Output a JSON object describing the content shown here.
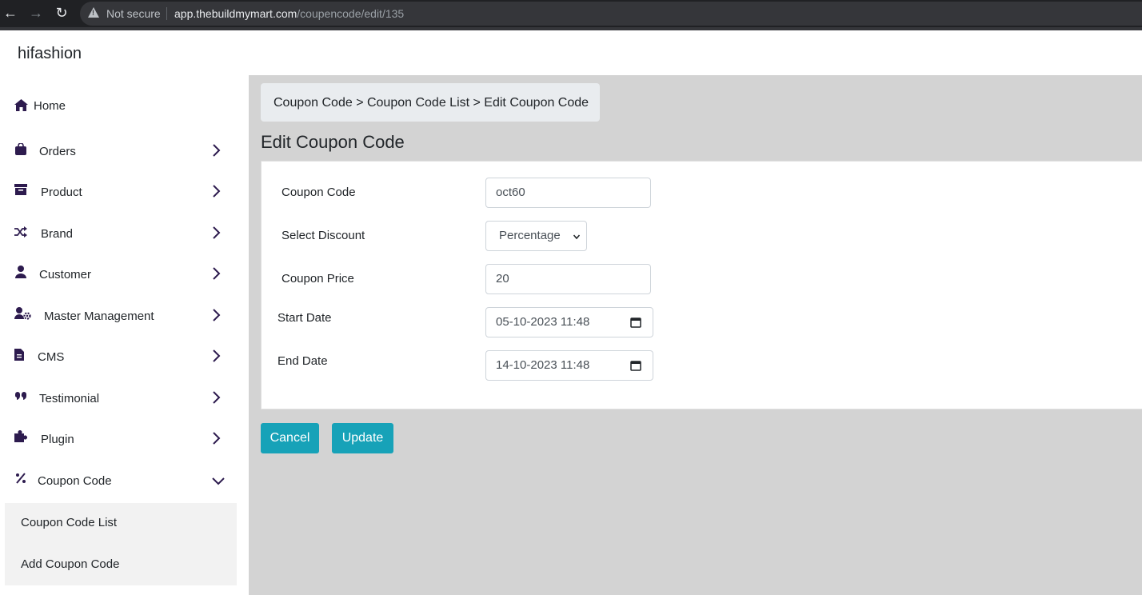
{
  "browser": {
    "security_label": "Not secure",
    "url_host": "app.thebuildmymart.com",
    "url_path": "/coupencode/edit/135"
  },
  "header": {
    "brand": "hifashion"
  },
  "sidebar": {
    "items": [
      {
        "label": "Home",
        "icon": "home-icon"
      },
      {
        "label": "Orders",
        "icon": "shopping-bag-icon"
      },
      {
        "label": "Product",
        "icon": "archive-box-icon"
      },
      {
        "label": "Brand",
        "icon": "shuffle-icon"
      },
      {
        "label": "Customer",
        "icon": "user-icon"
      },
      {
        "label": "Master Management",
        "icon": "user-gear-icon"
      },
      {
        "label": "CMS",
        "icon": "document-icon"
      },
      {
        "label": "Testimonial",
        "icon": "quote-icon"
      },
      {
        "label": "Plugin",
        "icon": "puzzle-icon"
      },
      {
        "label": "Coupon Code",
        "icon": "percent-icon"
      }
    ],
    "submenu": [
      {
        "label": "Coupon Code List"
      },
      {
        "label": "Add Coupon Code"
      }
    ]
  },
  "breadcrumb": "Coupon Code > Coupon Code List > Edit Coupon Code",
  "page_title": "Edit Coupon Code",
  "form": {
    "coupon_code": {
      "label": "Coupon Code",
      "value": "oct60"
    },
    "discount": {
      "label": "Select Discount",
      "value": "Percentage"
    },
    "price": {
      "label": "Coupon Price",
      "value": "20"
    },
    "start_date": {
      "label": "Start Date",
      "value": "05-10-2023 11:48"
    },
    "end_date": {
      "label": "End Date",
      "value": "14-10-2023 11:48"
    }
  },
  "buttons": {
    "cancel": "Cancel",
    "update": "Update"
  },
  "colors": {
    "primary": "#17a2b8",
    "icon": "#2d1b4e",
    "content_bg": "#d3d3d3"
  }
}
